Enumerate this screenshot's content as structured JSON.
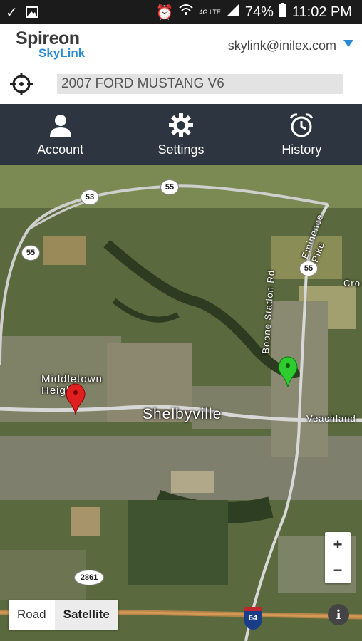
{
  "statusbar": {
    "battery": "74%",
    "time": "11:02 PM",
    "network": "4G LTE"
  },
  "header": {
    "brand_name": "Spireon",
    "product_name": "SkyLink",
    "user_email": "skylink@inilex.com",
    "vehicle_name": "2007 FORD MUSTANG V6"
  },
  "nav": {
    "items": [
      {
        "label": "Account",
        "icon": "person-icon"
      },
      {
        "label": "Settings",
        "icon": "gear-icon"
      },
      {
        "label": "History",
        "icon": "alarm-clock-icon"
      }
    ]
  },
  "map": {
    "labels": {
      "town_main": "Shelbyville",
      "town_secondary": "Middletown Heights",
      "road_station": "Boone Station Rd",
      "road_eminence": "Eminence Pike",
      "road_veach": "Veachland",
      "road_cro": "Cro"
    },
    "route_badges": [
      "53",
      "55",
      "55",
      "55",
      "2861",
      "64"
    ],
    "zoom_in": "+",
    "zoom_out": "−",
    "map_type": {
      "road": "Road",
      "satellite": "Satellite",
      "selected": "Satellite"
    },
    "info": "i",
    "markers": [
      {
        "name": "red-location-pin",
        "color": "#e02020"
      },
      {
        "name": "green-location-pin",
        "color": "#2ecc2e"
      }
    ]
  }
}
